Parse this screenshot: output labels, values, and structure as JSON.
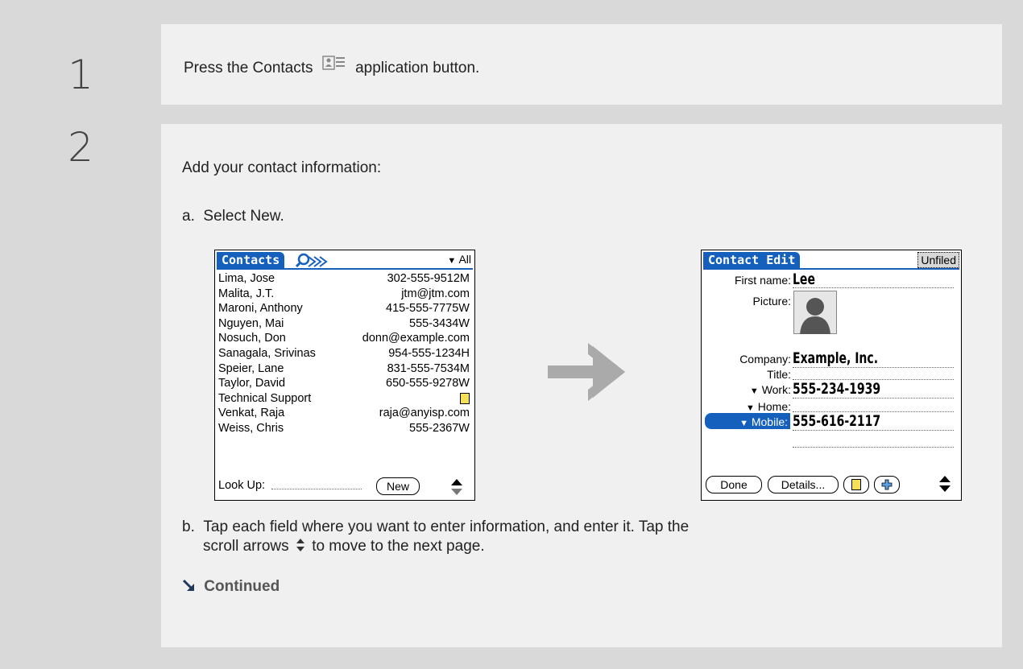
{
  "steps": [
    {
      "number": "1",
      "text_before": "Press the Contacts",
      "text_after": "application button.",
      "icon": "contacts-app-icon"
    },
    {
      "number": "2",
      "intro": "Add your contact information:",
      "sub_a": {
        "letter": "a.",
        "text": "Select New."
      },
      "sub_b": {
        "letter": "b.",
        "line1": "Tap each field where you want to enter information, and enter it. Tap the",
        "line2_before": "scroll arrows",
        "line2_after": "to move to the next page.",
        "icon": "scroll-arrows-icon"
      },
      "continued": "Continued"
    }
  ],
  "contacts_screen": {
    "title": "Contacts",
    "category": "All",
    "rows": [
      {
        "name": "Lima, Jose",
        "value": "302-555-9512M"
      },
      {
        "name": "Malita, J.T.",
        "value": "jtm@jtm.com"
      },
      {
        "name": "Maroni, Anthony",
        "value": "415-555-7775W"
      },
      {
        "name": "Nguyen, Mai",
        "value": "555-3434W"
      },
      {
        "name": "Nosuch, Don",
        "value": "donn@example.com"
      },
      {
        "name": "Sanagala, Srivinas",
        "value": "954-555-1234H"
      },
      {
        "name": "Speier, Lane",
        "value": "831-555-7534M"
      },
      {
        "name": "Taylor, David",
        "value": "650-555-9278W"
      },
      {
        "name": "Technical Support",
        "value": ""
      },
      {
        "name": "Venkat, Raja",
        "value": "raja@anyisp.com"
      },
      {
        "name": "Weiss, Chris",
        "value": "555-2367W"
      }
    ],
    "lookup_label": "Look Up:",
    "new_button": "New"
  },
  "edit_screen": {
    "title": "Contact Edit",
    "category": "Unfiled",
    "fields": {
      "first_name": {
        "label": "First name:",
        "value": "Lee"
      },
      "picture": {
        "label": "Picture:"
      },
      "company": {
        "label": "Company:",
        "value": "Example, Inc."
      },
      "title": {
        "label": "Title:",
        "value": ""
      },
      "work": {
        "label": "Work:",
        "value": "555-234-1939"
      },
      "home": {
        "label": "Home:",
        "value": ""
      },
      "mobile": {
        "label": "Mobile:",
        "value": "555-616-2117"
      }
    },
    "buttons": {
      "done": "Done",
      "details": "Details..."
    }
  },
  "colors": {
    "band": "#d9d9d9",
    "panel": "#f0f0f0",
    "palm_blue": "#1560bd",
    "arrow": "#aaaaaa",
    "continued_arrow": "#1f3a5a"
  }
}
